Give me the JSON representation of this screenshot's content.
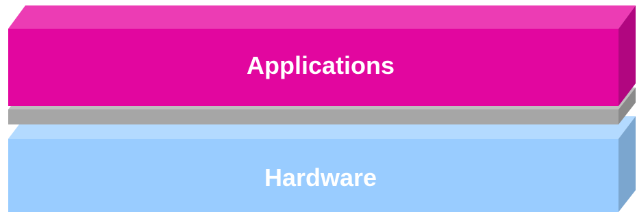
{
  "layers": {
    "applications": {
      "label": "Applications",
      "front_color": "#E2069F",
      "top_color": "#EC3CB4",
      "side_color": "#B10680"
    },
    "middle": {
      "label": "",
      "front_color": "#A6A6A6",
      "top_color": "#BEBEBE",
      "side_color": "#8A8A8A"
    },
    "hardware": {
      "label": "Hardware",
      "front_color": "#99CCFF",
      "top_color": "#B3DAFF",
      "side_color": "#7BA6CF"
    }
  }
}
